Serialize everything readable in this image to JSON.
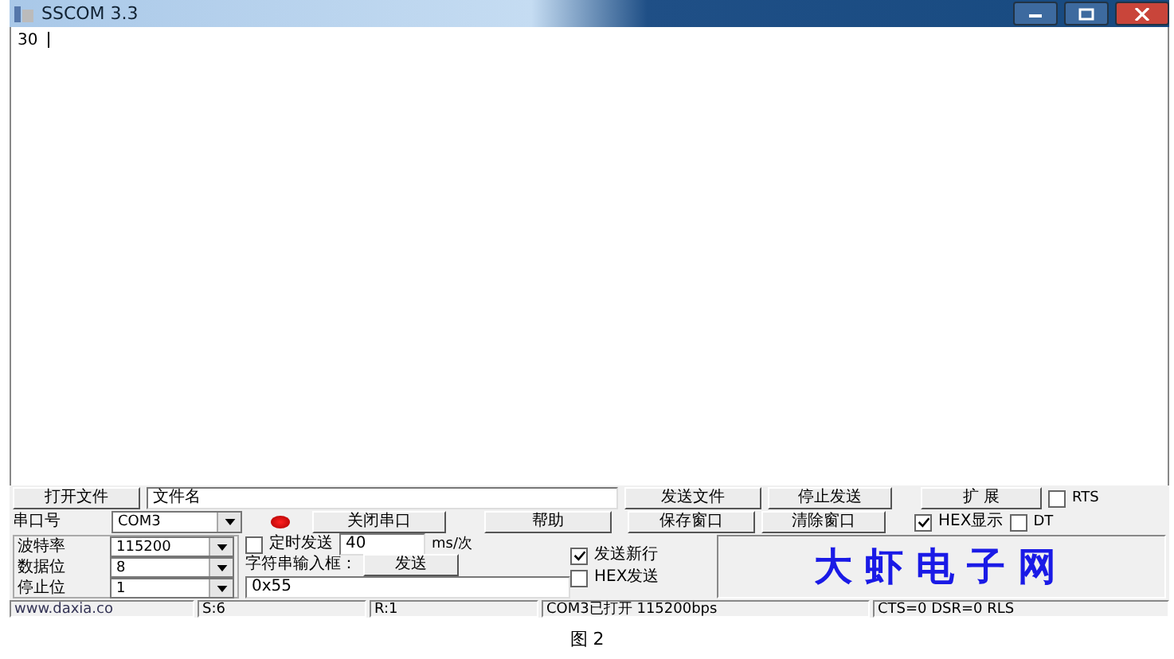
{
  "window": {
    "title": "SSCOM 3.3"
  },
  "receive_text": "30",
  "file": {
    "open_button": "打开文件",
    "filename": "文件名"
  },
  "buttons_row1": [
    "发送文件",
    "停止发送",
    "扩 展"
  ],
  "port": {
    "label": "串口号",
    "value": "COM3",
    "open": true
  },
  "buttons_row2": [
    "关闭串口",
    "帮助",
    "保存窗口",
    "清除窗口"
  ],
  "hex_display": {
    "label": "HEX显示",
    "checked": true
  },
  "line_signals": [
    {
      "label": "RTS",
      "checked": false
    },
    {
      "label": "DT",
      "checked": false
    }
  ],
  "settings": [
    {
      "label": "波特率",
      "value": "115200"
    },
    {
      "label": "数据位",
      "value": "8"
    },
    {
      "label": "停止位",
      "value": "1"
    }
  ],
  "timed_send": {
    "label": "定时发送",
    "checked": false,
    "interval": "40",
    "unit": "ms/次"
  },
  "string_input": {
    "label": "字符串输入框：",
    "send_button": "发送",
    "value": "0x55"
  },
  "options": [
    {
      "label": "发送新行",
      "checked": true
    },
    {
      "label": "HEX发送",
      "checked": false
    }
  ],
  "banner": "大虾电子网",
  "status_bar": [
    "www.daxia.co",
    "S:6",
    "R:1",
    "COM3已打开  115200bps",
    "CTS=0 DSR=0 RLS"
  ],
  "caption": "图 2"
}
